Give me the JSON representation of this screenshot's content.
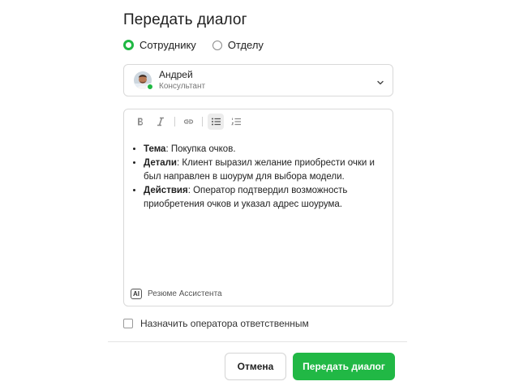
{
  "dialog": {
    "title": "Передать диалог"
  },
  "transfer_target": {
    "options": [
      {
        "label": "Сотруднику",
        "checked": true
      },
      {
        "label": "Отделу",
        "checked": false
      }
    ]
  },
  "assignee": {
    "name": "Андрей",
    "role": "Консультант",
    "status": "online",
    "icon": "chevron-down-icon"
  },
  "toolbar": {
    "items": [
      "bold-icon",
      "italic-icon",
      "link-icon",
      "bulleted-list-icon",
      "numbered-list-icon"
    ],
    "active": "bulleted-list-icon"
  },
  "summary": {
    "items": [
      {
        "label": "Тема",
        "text": ": Покупка очков."
      },
      {
        "label": "Детали",
        "text": ": Клиент выразил желание приобрести очки и был направлен в шоурум для выбора модели."
      },
      {
        "label": "Действия",
        "text": ": Оператор подтвердил возможность приобретения очков и указал адрес шоурума."
      }
    ],
    "ai_badge": "AI",
    "ai_label": "Резюме Ассистента"
  },
  "assign_responsible": {
    "label": "Назначить оператора ответственным",
    "checked": false
  },
  "actions": {
    "cancel_label": "Отмена",
    "submit_label": "Передать диалог"
  },
  "colors": {
    "accent": "#21b845",
    "border": "#d9d9d9"
  }
}
